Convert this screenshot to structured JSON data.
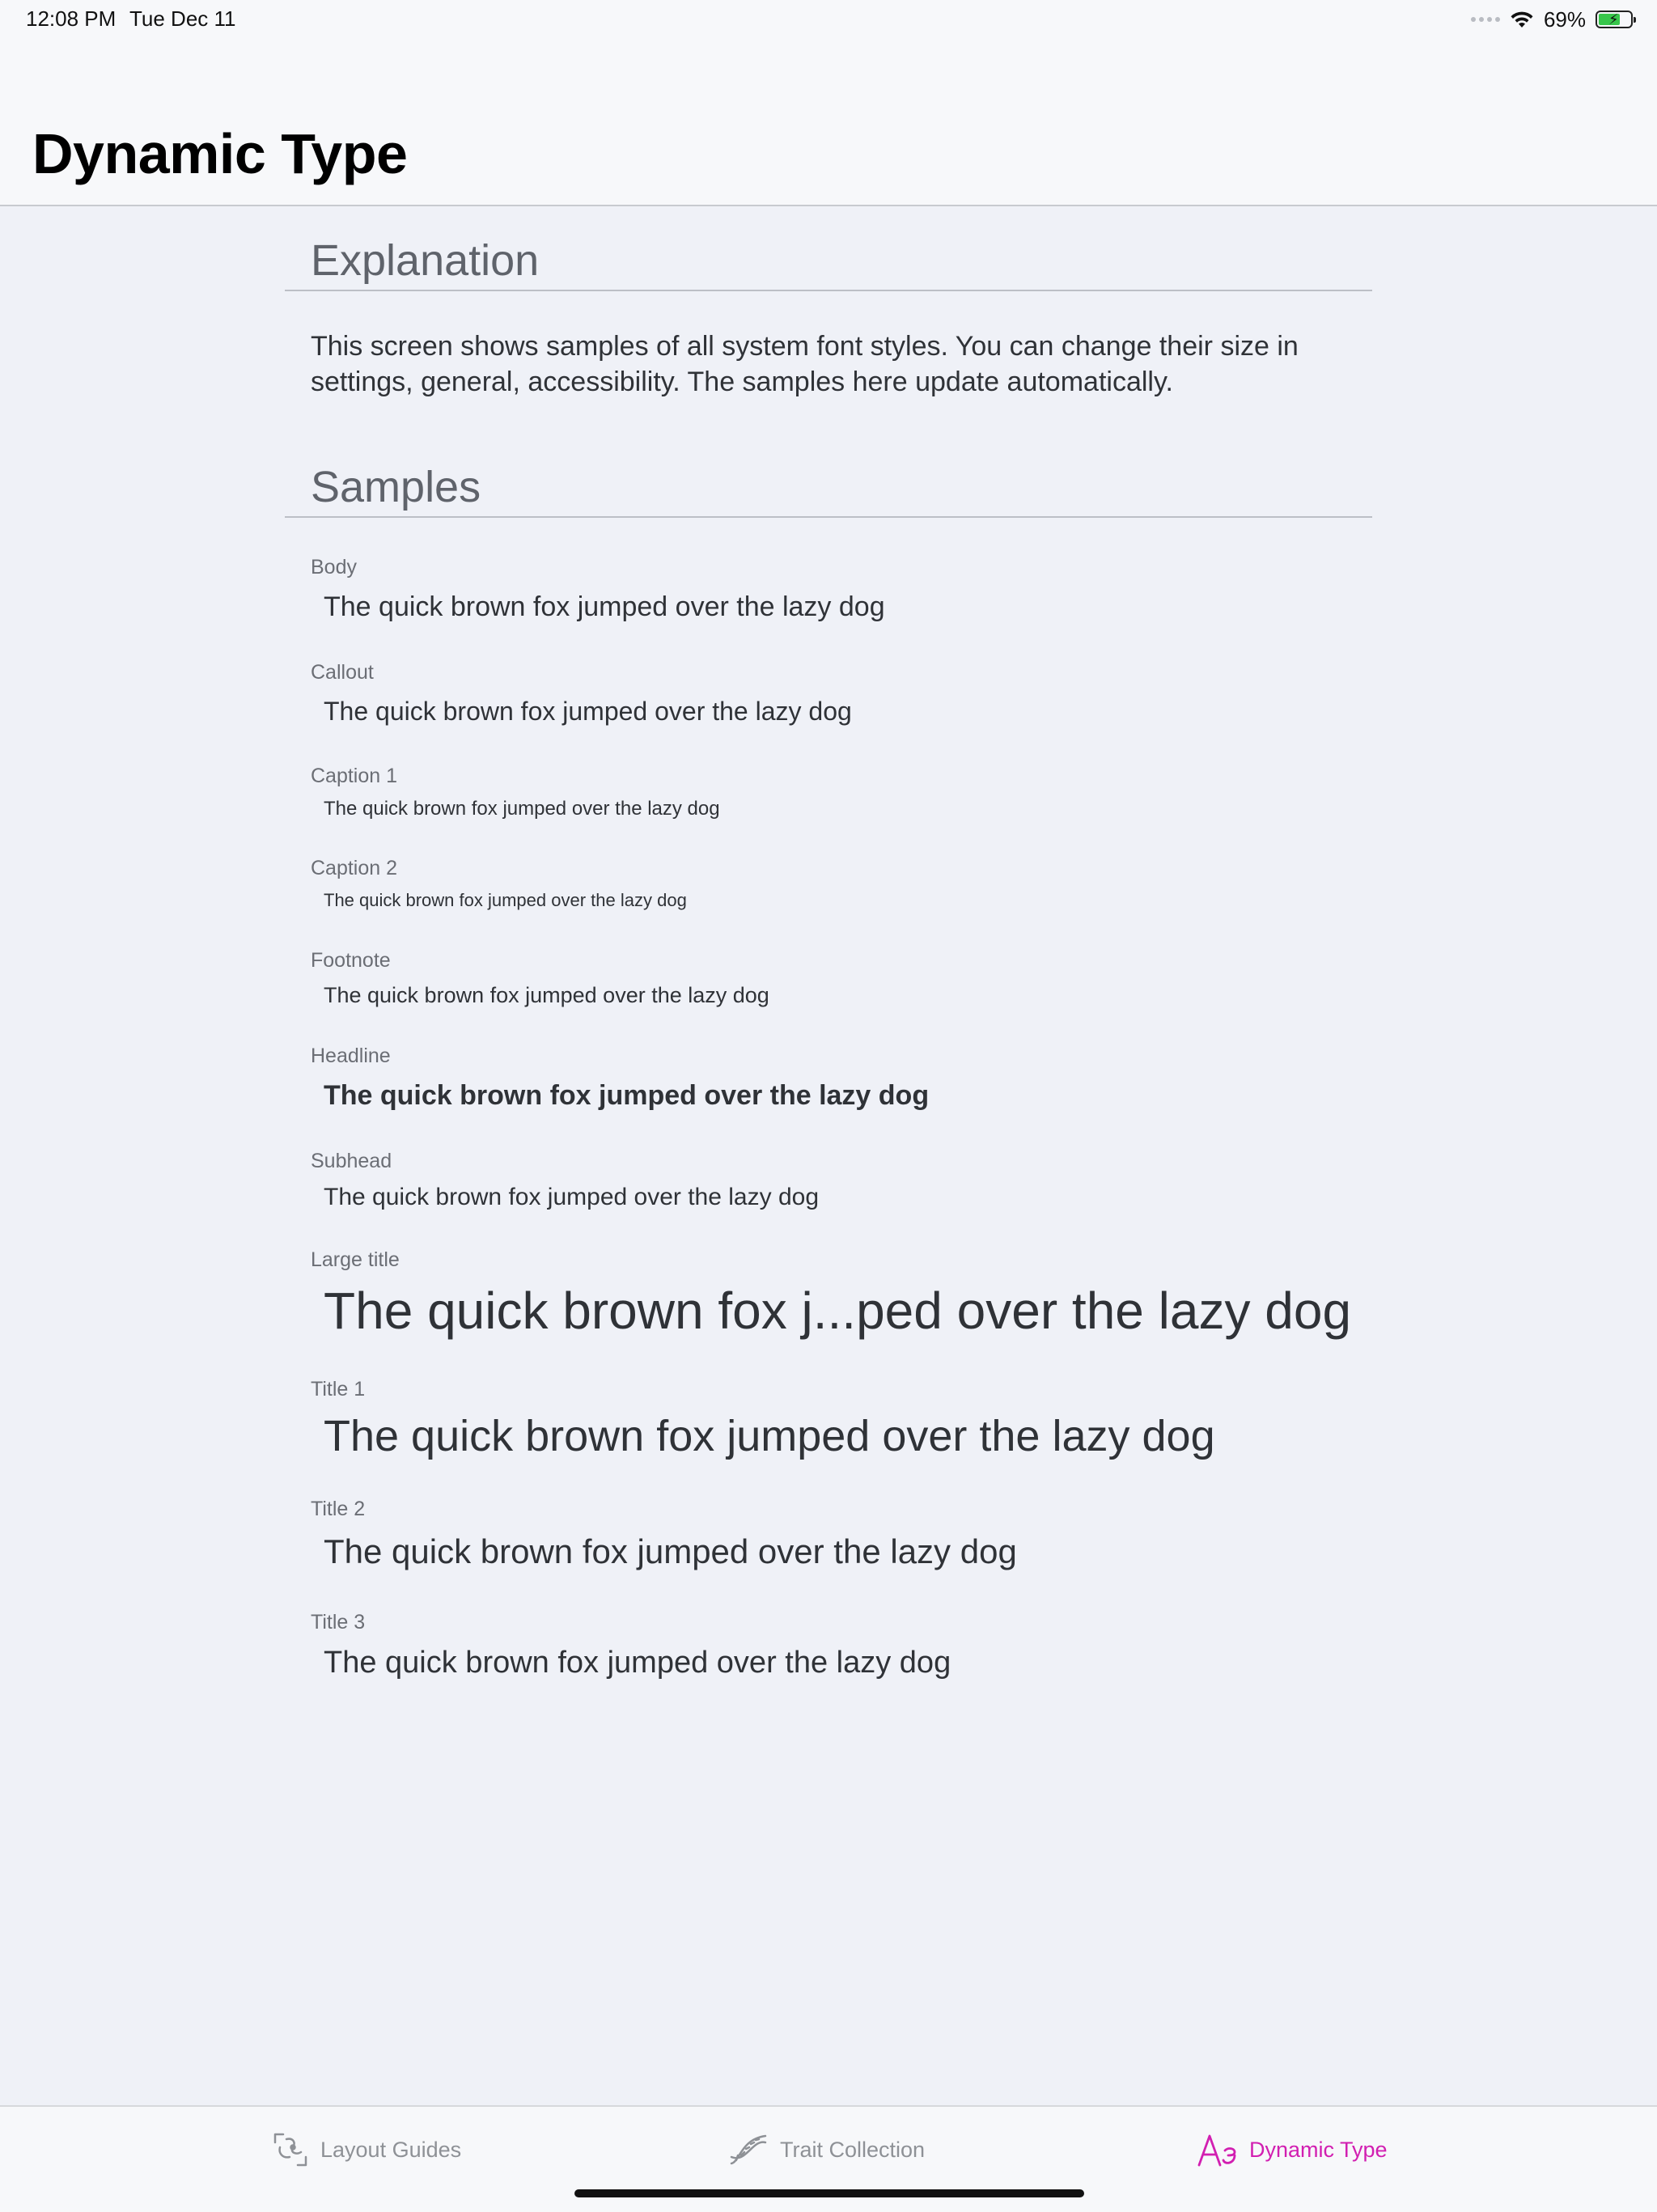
{
  "status_bar": {
    "time": "12:08 PM",
    "date": "Tue Dec 11",
    "battery_percent": "69%",
    "battery_level": 0.69
  },
  "header": {
    "title": "Dynamic Type"
  },
  "explanation": {
    "heading": "Explanation",
    "text": "This screen shows samples of all system font styles. You can change their size in settings, general, accessibility. The samples here update automatically."
  },
  "samples": {
    "heading": "Samples",
    "items": [
      {
        "label": "Body",
        "text": "The quick brown fox jumped over the lazy dog"
      },
      {
        "label": "Callout",
        "text": "The quick brown fox jumped over the lazy dog"
      },
      {
        "label": "Caption 1",
        "text": "The quick brown fox jumped over the lazy dog"
      },
      {
        "label": "Caption 2",
        "text": "The quick brown fox jumped over the lazy dog"
      },
      {
        "label": "Footnote",
        "text": "The quick brown fox jumped over the lazy dog"
      },
      {
        "label": "Headline",
        "text": "The quick brown fox jumped over the lazy dog"
      },
      {
        "label": "Subhead",
        "text": "The quick brown fox jumped over the lazy dog"
      },
      {
        "label": "Large title",
        "text": "The quick brown fox j...ped over the lazy dog"
      },
      {
        "label": "Title 1",
        "text": "The quick brown fox jumped over the lazy dog"
      },
      {
        "label": "Title 2",
        "text": "The quick brown fox jumped over the lazy dog"
      },
      {
        "label": "Title 3",
        "text": "The quick brown fox jumped over the lazy dog"
      }
    ]
  },
  "tab_bar": {
    "active_color": "#d21fb1",
    "inactive_color": "#8e9196",
    "tabs": [
      {
        "label": "Layout Guides",
        "icon": "layout-guides-icon"
      },
      {
        "label": "Trait Collection",
        "icon": "dna-icon"
      },
      {
        "label": "Dynamic Type",
        "icon": "text-size-icon"
      }
    ]
  }
}
